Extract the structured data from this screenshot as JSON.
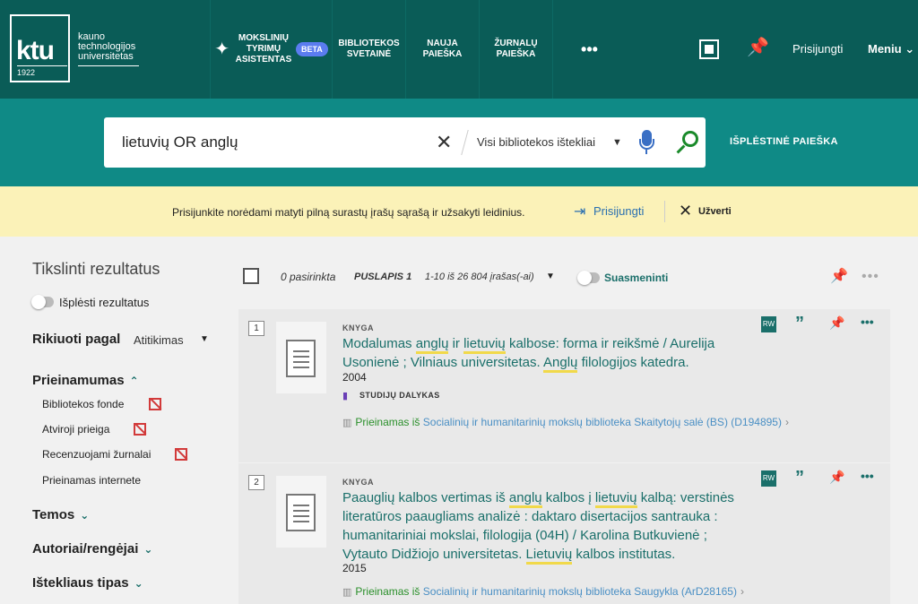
{
  "header": {
    "logo_main": "ktu",
    "logo_text": "kauno technologijos universitetas",
    "logo_year": "1922",
    "nav": {
      "assistant": "Mokslinių tyrimų asistentas",
      "beta": "BETA",
      "library_site": "Bibliotekos svetainė",
      "new_search": "Nauja paieška",
      "journal_search": "Žurnalų paieška",
      "more": "•••"
    },
    "login": "Prisijungti",
    "menu": "Meniu"
  },
  "search": {
    "query": "lietuvių OR anglų",
    "scope": "Visi bibliotekos ištekliai",
    "advanced": "Išplėstinė paieška"
  },
  "notice": {
    "text": "Prisijunkite norėdami matyti pilną surastų įrašų sąrašą ir užsakyti leidinius.",
    "login": "Prisijungti",
    "close": "Užverti"
  },
  "sidebar": {
    "title": "Tikslinti rezultatus",
    "expand": "Išplėsti rezultatus",
    "sort_label": "Rikiuoti pagal",
    "sort_value": "Atitikimas",
    "availability": {
      "head": "Prieinamumas",
      "items": [
        "Bibliotekos fonde",
        "Atviroji prieiga",
        "Recenzuojami žurnalai",
        "Prieinamas internete"
      ]
    },
    "facets": [
      "Temos",
      "Autoriai/rengėjai",
      "Ištekliaus tipas"
    ]
  },
  "toolbar": {
    "selected": "0 pasirinkta",
    "page": "PUSLAPIS 1",
    "range": "1-10 iš 26 804 įrašas(-ai)",
    "group": "Suasmeninti"
  },
  "results": [
    {
      "num": "1",
      "type": "KNYGA",
      "title_parts": [
        "Modalumas ",
        "anglų",
        " ir ",
        "lietuvių",
        " kalbose: forma ir reikšmė / Aurelija Usonienė ; Vilniaus universitetas. ",
        "Anglų",
        " filologijos katedra."
      ],
      "year": "2004",
      "subject": "STUDIJŲ DALYKAS",
      "avail_status": "Prieinamas iš",
      "avail_loc": "Socialinių ir humanitarinių mokslų biblioteka  Skaitytojų salė (BS) (D194895)",
      "rw": "RW"
    },
    {
      "num": "2",
      "type": "KNYGA",
      "title_parts": [
        "Paauglių kalbos vertimas iš ",
        "anglų",
        " kalbos į ",
        "lietuvių",
        " kalbą: verstinės literatūros paaugliams analizė : daktaro disertacijos santrauka : humanitariniai mokslai, filologija (04H) / Karolina Butkuvienė ; Vytauto Didžiojo universitetas. ",
        "Lietuvių",
        " kalbos institutas."
      ],
      "year": "2015",
      "avail_status": "Prieinamas iš",
      "avail_loc": "Socialinių ir humanitarinių mokslų biblioteka  Saugykla (ArD28165)",
      "rw": "RW"
    }
  ]
}
